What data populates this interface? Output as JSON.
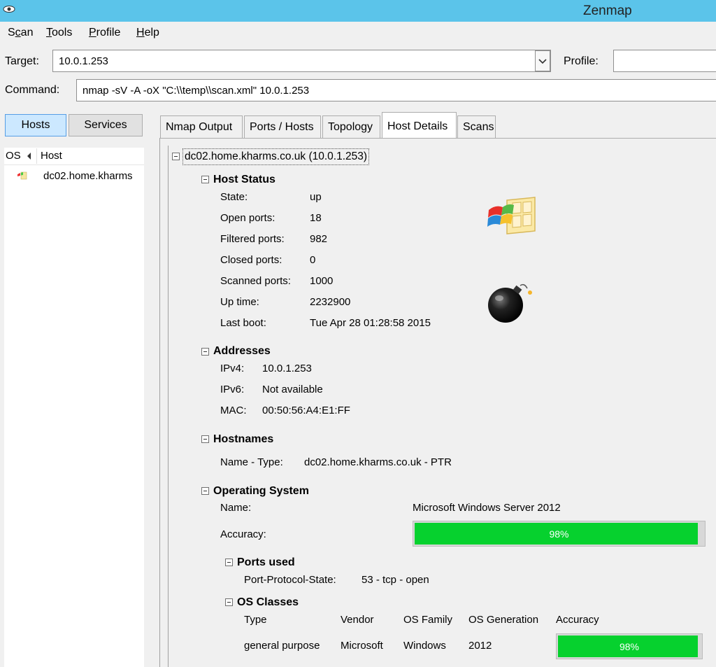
{
  "window": {
    "title": "Zenmap"
  },
  "menu": {
    "scan_pre": "S",
    "scan_u": "c",
    "scan_post": "an",
    "tools_u": "T",
    "tools_post": "ools",
    "profile_u": "P",
    "profile_post": "rofile",
    "help_u": "H",
    "help_post": "elp"
  },
  "target": {
    "label": "Target:",
    "value": "10.0.1.253"
  },
  "profile": {
    "label": "Profile:",
    "value": ""
  },
  "command": {
    "label": "Command:",
    "value": "nmap -sV -A -oX \"C:\\\\temp\\\\scan.xml\" 10.0.1.253"
  },
  "left": {
    "hosts_btn": "Hosts",
    "services_btn": "Services",
    "col_os": "OS",
    "col_host": "Host",
    "host_row": "dc02.home.kharms"
  },
  "tabs": [
    "Nmap Output",
    "Ports / Hosts",
    "Topology",
    "Host Details",
    "Scans"
  ],
  "active_tab": "Host Details",
  "details": {
    "host_header": "dc02.home.kharms.co.uk (10.0.1.253)",
    "host_status": {
      "title": "Host Status",
      "rows": [
        {
          "label": "State:",
          "value": "up"
        },
        {
          "label": "Open ports:",
          "value": "18"
        },
        {
          "label": "Filtered ports:",
          "value": "982"
        },
        {
          "label": "Closed ports:",
          "value": "0"
        },
        {
          "label": "Scanned ports:",
          "value": "1000"
        },
        {
          "label": "Up time:",
          "value": "2232900"
        },
        {
          "label": "Last boot:",
          "value": "Tue Apr 28 01:28:58 2015"
        }
      ]
    },
    "addresses": {
      "title": "Addresses",
      "rows": [
        {
          "label": "IPv4:",
          "value": "10.0.1.253"
        },
        {
          "label": "IPv6:",
          "value": "Not available"
        },
        {
          "label": "MAC:",
          "value": "00:50:56:A4:E1:FF"
        }
      ]
    },
    "hostnames": {
      "title": "Hostnames",
      "label": "Name - Type:",
      "value": "dc02.home.kharms.co.uk - PTR"
    },
    "os": {
      "title": "Operating System",
      "name_label": "Name:",
      "name_value": "Microsoft Windows Server 2012",
      "accuracy_label": "Accuracy:",
      "accuracy_value": "98%",
      "accuracy_fraction": 0.98,
      "ports_used": {
        "title": "Ports used",
        "label": "Port-Protocol-State:",
        "value": "53 - tcp - open"
      },
      "os_classes": {
        "title": "OS Classes",
        "headers": [
          "Type",
          "Vendor",
          "OS Family",
          "OS Generation",
          "Accuracy"
        ],
        "row": {
          "type": "general purpose",
          "vendor": "Microsoft",
          "family": "Windows",
          "generation": "2012",
          "accuracy": "98%",
          "accuracy_fraction": 0.98
        }
      }
    }
  },
  "colors": {
    "titlebar": "#5bc4ea",
    "accuracy_bar": "#06d12e",
    "hosts_active": "#cce8ff"
  },
  "icons": {
    "os": "windows-logo-icon",
    "uptime": "bomb-icon"
  }
}
